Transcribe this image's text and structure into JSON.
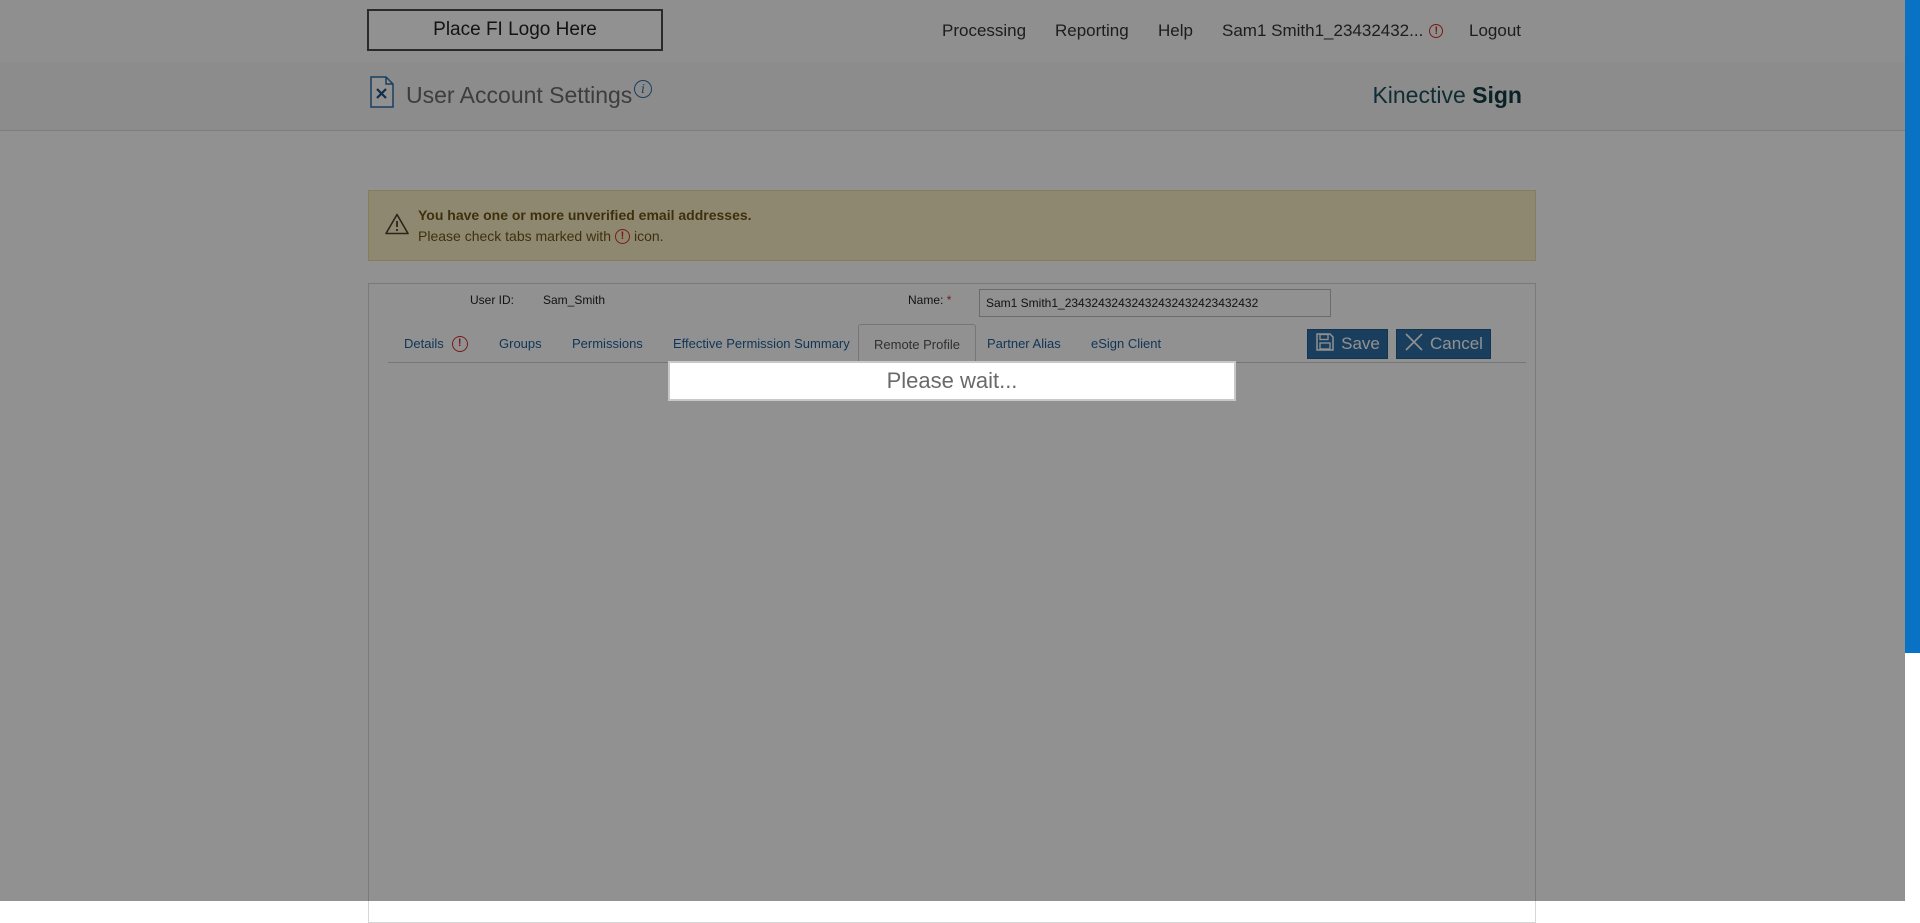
{
  "header": {
    "logo_text": "Place FI Logo Here",
    "nav": {
      "processing": "Processing",
      "reporting": "Reporting",
      "help": "Help",
      "user_name": "Sam1 Smith1_23432432...",
      "logout": "Logout"
    }
  },
  "title_bar": {
    "page_title": "User Account Settings",
    "brand_light": "Kinective",
    "brand_bold": "Sign"
  },
  "warning": {
    "line1": "You have one or more unverified email addresses.",
    "line2_before": "Please check tabs marked with",
    "line2_after": "icon."
  },
  "form": {
    "user_id_label": "User ID:",
    "user_id_value": "Sam_Smith",
    "name_label": "Name:",
    "name_required": "*",
    "name_value": "Sam1 Smith1_23432432432432432432423432432"
  },
  "tabs": [
    {
      "label": "Details"
    },
    {
      "label": "Groups"
    },
    {
      "label": "Permissions"
    },
    {
      "label": "Effective Permission Summary"
    },
    {
      "label": "Remote Profile"
    },
    {
      "label": "Partner Alias"
    },
    {
      "label": "eSign Client"
    }
  ],
  "actions": {
    "save": "Save",
    "cancel": "Cancel"
  },
  "overlay": {
    "wait_text": "Please wait..."
  },
  "colors": {
    "accent": "#2f6fa6",
    "warning_bg": "#fcf0c6",
    "alert": "#d0302b",
    "scrollbar": "#0a72c4"
  }
}
